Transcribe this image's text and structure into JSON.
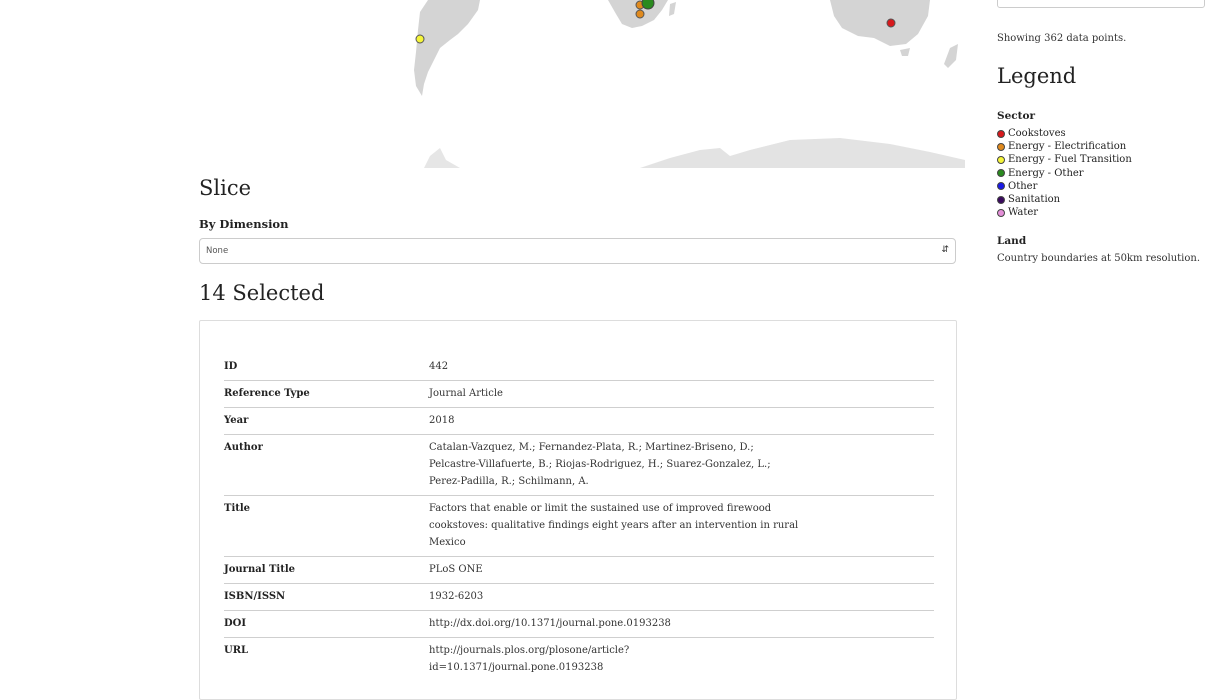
{
  "slice": {
    "title": "Slice",
    "dimension_label": "By Dimension",
    "dimension_value": "None"
  },
  "selection": {
    "title": "14 Selected",
    "record": {
      "id": {
        "label": "ID",
        "value": "442"
      },
      "reference_type": {
        "label": "Reference Type",
        "value": "Journal Article"
      },
      "year": {
        "label": "Year",
        "value": "2018"
      },
      "author": {
        "label": "Author",
        "lines": [
          "Catalan-Vazquez, M.; Fernandez-Plata, R.; Martinez-Briseno, D.;",
          "Pelcastre-Villafuerte, B.; Riojas-Rodriguez, H.; Suarez-Gonzalez, L.;",
          "Perez-Padilla, R.; Schilmann, A."
        ]
      },
      "title": {
        "label": "Title",
        "lines": [
          "Factors that enable or limit the sustained use of improved firewood",
          "cookstoves: qualitative findings eight years after an intervention in rural",
          "Mexico"
        ]
      },
      "journal_title": {
        "label": "Journal Title",
        "value": "PLoS ONE"
      },
      "isbn_issn": {
        "label": "ISBN/ISSN",
        "value": "1932-6203"
      },
      "doi": {
        "label": "DOI",
        "value": "http://dx.doi.org/10.1371/journal.pone.0193238"
      },
      "url": {
        "label": "URL",
        "lines": [
          "http://journals.plos.org/plosone/article?",
          "id=10.1371/journal.pone.0193238"
        ]
      }
    }
  },
  "sidebar": {
    "showing_text": "Showing 362 data points.",
    "legend_title": "Legend",
    "sector_title": "Sector",
    "sectors": [
      {
        "label": "Cookstoves",
        "color": "#d7191c"
      },
      {
        "label": "Energy - Electrification",
        "color": "#e08a1e"
      },
      {
        "label": "Energy - Fuel Transition",
        "color": "#f5f53a"
      },
      {
        "label": "Energy - Other",
        "color": "#2a8a1f"
      },
      {
        "label": "Other",
        "color": "#1a1ae6"
      },
      {
        "label": "Sanitation",
        "color": "#3a0a5e"
      },
      {
        "label": "Water",
        "color": "#e48fd8"
      }
    ],
    "land_title": "Land",
    "land_description": "Country boundaries at 50km resolution."
  },
  "map": {
    "land_color": "#d4d4d4",
    "point_colors": [
      "#f5f53a",
      "#e08a1e",
      "#2a8a1f",
      "#d7191c"
    ]
  }
}
